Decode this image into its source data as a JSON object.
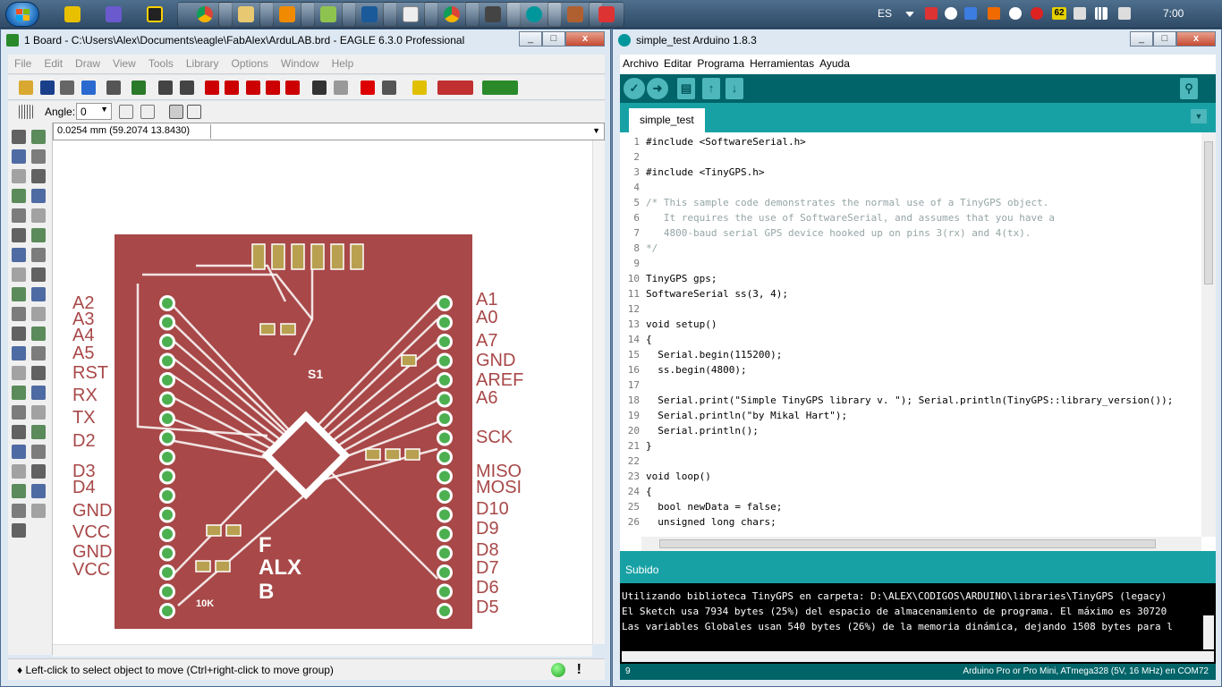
{
  "taskbar": {
    "language": "ES",
    "clock": "7:00",
    "badge": "62",
    "pinned_icons": [
      "chrome-icon",
      "explorer-icon",
      "media-icon",
      "terminal-icon",
      "notepad-icon",
      "chrome-icon",
      "arduino-icon"
    ],
    "quick_icons": [
      "winamp-icon",
      "inkscape-icon",
      "app-n-icon"
    ]
  },
  "eagle": {
    "title": "1 Board - C:\\Users\\Alex\\Documents\\eagle\\FabAlex\\ArduLAB.brd - EAGLE 6.3.0 Professional",
    "menu": [
      "File",
      "Edit",
      "Draw",
      "View",
      "Tools",
      "Library",
      "Options",
      "Window",
      "Help"
    ],
    "angle_label": "Angle:",
    "angle_value": "0",
    "coord": "0.0254 mm (59.2074 13.8430)",
    "status": "♦ Left-click to select object to move (Ctrl+right-click to move group)",
    "excl": "!",
    "board": {
      "color": "#a84848",
      "left_labels": [
        "A2",
        "A3",
        "A4",
        "A5",
        "RST",
        "RX",
        "TX",
        "D2",
        "D3",
        "D4",
        "GND",
        "VCC",
        "GND",
        "VCC"
      ],
      "right_labels": [
        "A1",
        "A0",
        "A7",
        "GND",
        "AREF",
        "A6",
        "SCK",
        "MISO",
        "MOSI",
        "D10",
        "D9",
        "D8",
        "D7",
        "D6",
        "D5"
      ],
      "silkscreen": [
        "F",
        "ALX",
        "B",
        "S1",
        "10K"
      ]
    }
  },
  "arduino": {
    "title": "simple_test Arduino 1.8.3",
    "menu": [
      "Archivo",
      "Editar",
      "Programa",
      "Herramientas",
      "Ayuda"
    ],
    "tab": "simple_test",
    "code_lines": [
      {
        "n": "1",
        "t": "#include <SoftwareSerial.h>"
      },
      {
        "n": "2",
        "t": ""
      },
      {
        "n": "3",
        "t": "#include <TinyGPS.h>"
      },
      {
        "n": "4",
        "t": ""
      },
      {
        "n": "5",
        "t": "/* This sample code demonstrates the normal use of a TinyGPS object."
      },
      {
        "n": "6",
        "t": "   It requires the use of SoftwareSerial, and assumes that you have a"
      },
      {
        "n": "7",
        "t": "   4800-baud serial GPS device hooked up on pins 3(rx) and 4(tx)."
      },
      {
        "n": "8",
        "t": "*/"
      },
      {
        "n": "9",
        "t": ""
      },
      {
        "n": "10",
        "t": "TinyGPS gps;"
      },
      {
        "n": "11",
        "t": "SoftwareSerial ss(3, 4);"
      },
      {
        "n": "12",
        "t": ""
      },
      {
        "n": "13",
        "t": "void setup()"
      },
      {
        "n": "14",
        "t": "{"
      },
      {
        "n": "15",
        "t": "  Serial.begin(115200);"
      },
      {
        "n": "16",
        "t": "  ss.begin(4800);"
      },
      {
        "n": "17",
        "t": ""
      },
      {
        "n": "18",
        "t": "  Serial.print(\"Simple TinyGPS library v. \"); Serial.println(TinyGPS::library_version());"
      },
      {
        "n": "19",
        "t": "  Serial.println(\"by Mikal Hart\");"
      },
      {
        "n": "20",
        "t": "  Serial.println();"
      },
      {
        "n": "21",
        "t": "}"
      },
      {
        "n": "22",
        "t": ""
      },
      {
        "n": "23",
        "t": "void loop()"
      },
      {
        "n": "24",
        "t": "{"
      },
      {
        "n": "25",
        "t": "  bool newData = false;"
      },
      {
        "n": "26",
        "t": "  unsigned long chars;"
      }
    ],
    "console_label": "Subido",
    "console_lines": [
      "Utilizando biblioteca TinyGPS en carpeta: D:\\ALEX\\CODIGOS\\ARDUINO\\libraries\\TinyGPS (legacy)",
      "El Sketch usa 7934 bytes (25%) del espacio de almacenamiento de programa. El máximo es 30720",
      "Las variables Globales usan 540 bytes (26%) de la memoria dinámica, dejando 1508 bytes para l"
    ],
    "status_line": "9",
    "status_board": "Arduino Pro or Pro Mini, ATmega328 (5V, 16 MHz) en COM72"
  }
}
